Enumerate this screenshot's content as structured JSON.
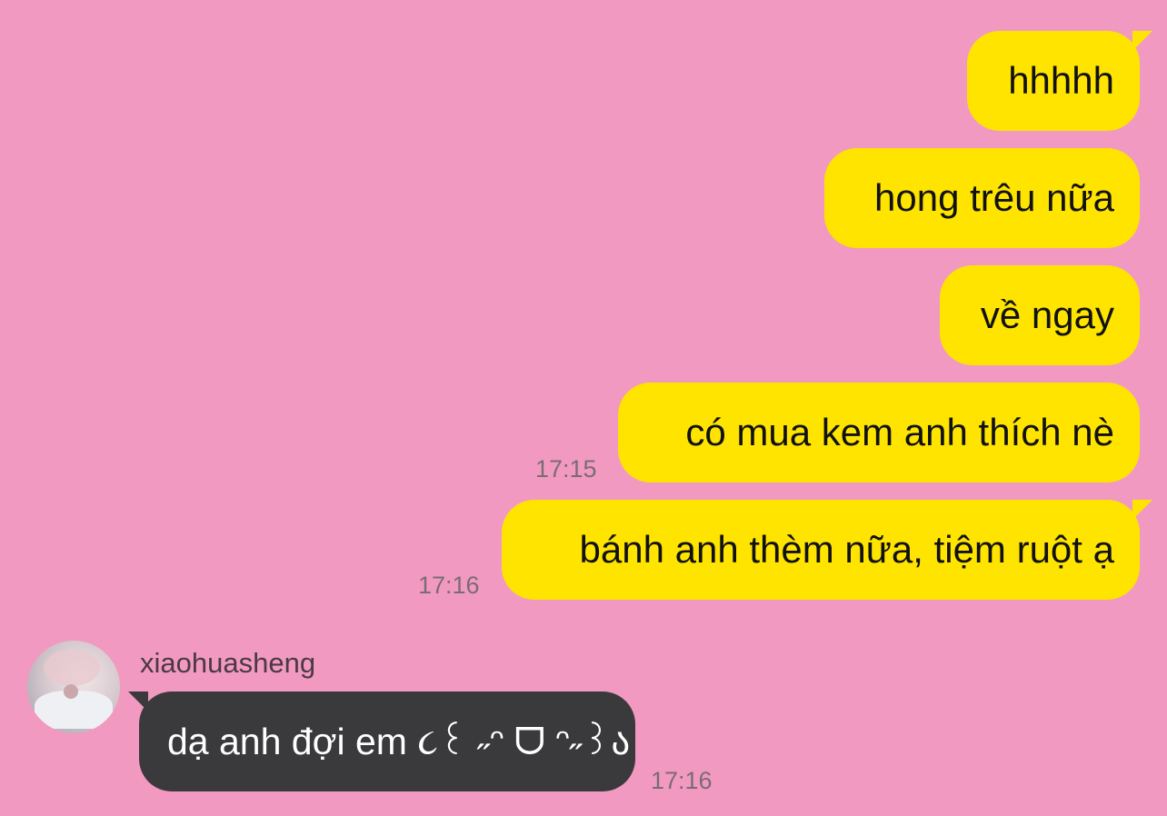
{
  "theme": {
    "background": "#F299C2",
    "outgoing_bubble": "#FFE400",
    "incoming_bubble": "#3A3A3C"
  },
  "messages": [
    {
      "direction": "outgoing",
      "text": "hhhhh",
      "time": ""
    },
    {
      "direction": "outgoing",
      "text": "hong trêu nữa",
      "time": ""
    },
    {
      "direction": "outgoing",
      "text": "về ngay",
      "time": ""
    },
    {
      "direction": "outgoing",
      "text": "có mua kem anh thích nè",
      "time": "17:15"
    },
    {
      "direction": "outgoing",
      "text": "bánh anh thèm nữa, tiệm ruột ạ",
      "time": "17:16"
    },
    {
      "direction": "incoming",
      "sender": "xiaohuasheng",
      "text": "dạ anh đợi em ૮꒰ ˶ᵔ ᗜ ᵔ˶꒱ა",
      "time": "17:16"
    }
  ]
}
